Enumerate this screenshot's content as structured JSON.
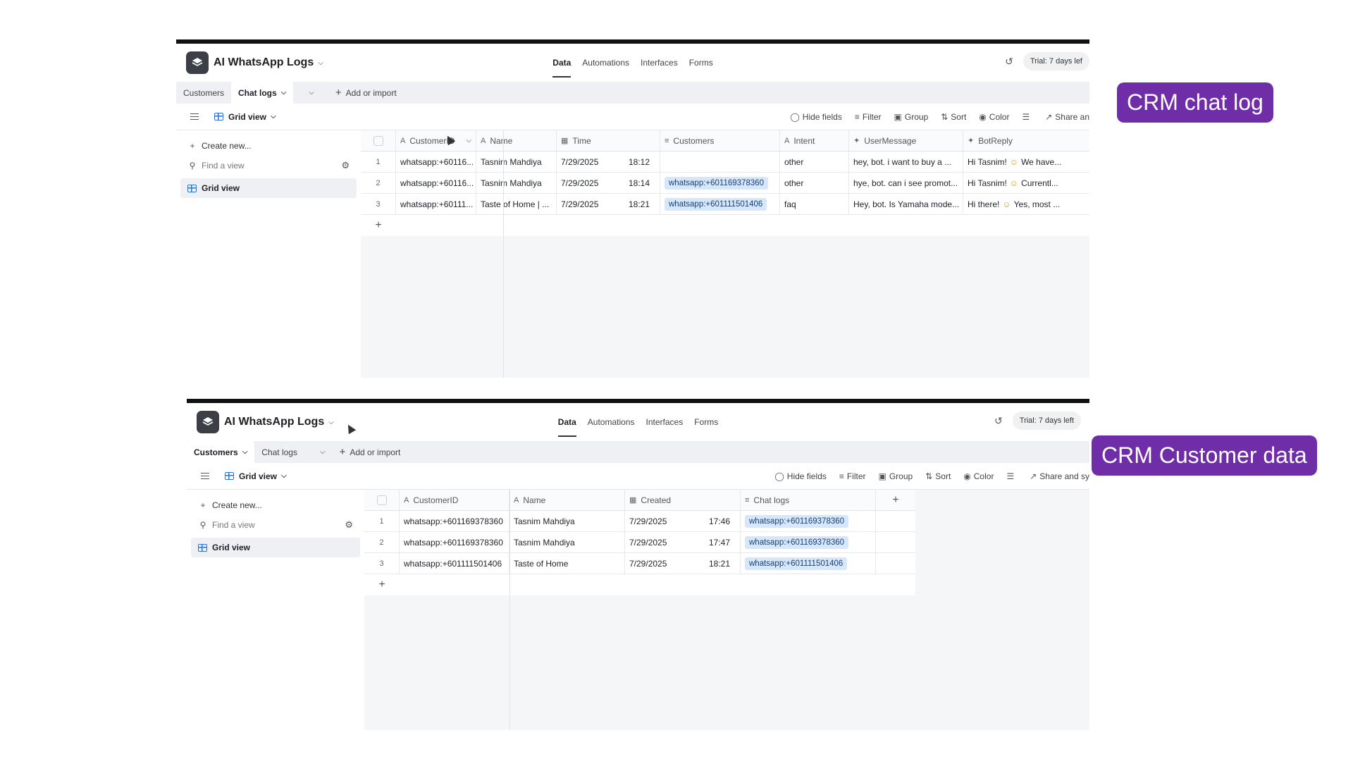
{
  "labels": {
    "chat_log": "CRM chat log",
    "customer_data": "CRM Customer data"
  },
  "panel1": {
    "base_name": "AI WhatsApp Logs",
    "nav": [
      "Data",
      "Automations",
      "Interfaces",
      "Forms"
    ],
    "trial": "Trial: 7 days lef",
    "tabs": [
      {
        "label": "Customers",
        "active": false
      },
      {
        "label": "Chat logs",
        "active": true
      }
    ],
    "add_import": "Add or import",
    "view_name": "Grid view",
    "tools": [
      "Hide fields",
      "Filter",
      "Group",
      "Sort",
      "Color",
      "Share an"
    ],
    "sidebar": {
      "create_new": "Create new...",
      "find_view": "Find a view",
      "grid_view": "Grid view"
    },
    "columns": [
      "CustomerID",
      "Name",
      "Time",
      "Customers",
      "Intent",
      "UserMessage",
      "BotReply"
    ],
    "rows": [
      {
        "n": "1",
        "customer_id": "whatsapp:+60116...",
        "name": "Tasnim Mahdiya",
        "date": "7/29/2025",
        "time": "18:12",
        "customers": "",
        "intent": "other",
        "user_message": "hey, bot. i want to buy a ...",
        "bot_reply_a": "Hi Tasnim!",
        "bot_reply_b": "We have..."
      },
      {
        "n": "2",
        "customer_id": "whatsapp:+60116...",
        "name": "Tasnim Mahdiya",
        "date": "7/29/2025",
        "time": "18:14",
        "customers": "whatsapp:+601169378360",
        "intent": "other",
        "user_message": "hye, bot. can i see promot...",
        "bot_reply_a": "Hi Tasnim!",
        "bot_reply_b": "Currentl..."
      },
      {
        "n": "3",
        "customer_id": "whatsapp:+60111...",
        "name": "Taste of Home | ...",
        "date": "7/29/2025",
        "time": "18:21",
        "customers": "whatsapp:+601111501406",
        "intent": "faq",
        "user_message": "Hey, bot. Is Yamaha mode...",
        "bot_reply_a": "Hi there!",
        "bot_reply_b": "Yes, most ..."
      }
    ]
  },
  "panel2": {
    "base_name": "AI WhatsApp Logs",
    "nav": [
      "Data",
      "Automations",
      "Interfaces",
      "Forms"
    ],
    "trial": "Trial: 7 days left",
    "tabs": [
      {
        "label": "Customers",
        "active": true
      },
      {
        "label": "Chat logs",
        "active": false
      }
    ],
    "add_import": "Add or import",
    "view_name": "Grid view",
    "tools": [
      "Hide fields",
      "Filter",
      "Group",
      "Sort",
      "Color",
      "Share and sy"
    ],
    "sidebar": {
      "create_new": "Create new...",
      "find_view": "Find a view",
      "grid_view": "Grid view"
    },
    "columns": [
      "CustomerID",
      "Name",
      "Created",
      "Chat logs"
    ],
    "rows": [
      {
        "n": "1",
        "customer_id": "whatsapp:+601169378360",
        "name": "Tasnim Mahdiya",
        "date": "7/29/2025",
        "time": "17:46",
        "chat_logs": "whatsapp:+601169378360"
      },
      {
        "n": "2",
        "customer_id": "whatsapp:+601169378360",
        "name": "Tasnim Mahdiya",
        "date": "7/29/2025",
        "time": "17:47",
        "chat_logs": "whatsapp:+601169378360"
      },
      {
        "n": "3",
        "customer_id": "whatsapp:+601111501406",
        "name": "Taste of Home",
        "date": "7/29/2025",
        "time": "18:21",
        "chat_logs": "whatsapp:+601111501406"
      }
    ]
  }
}
